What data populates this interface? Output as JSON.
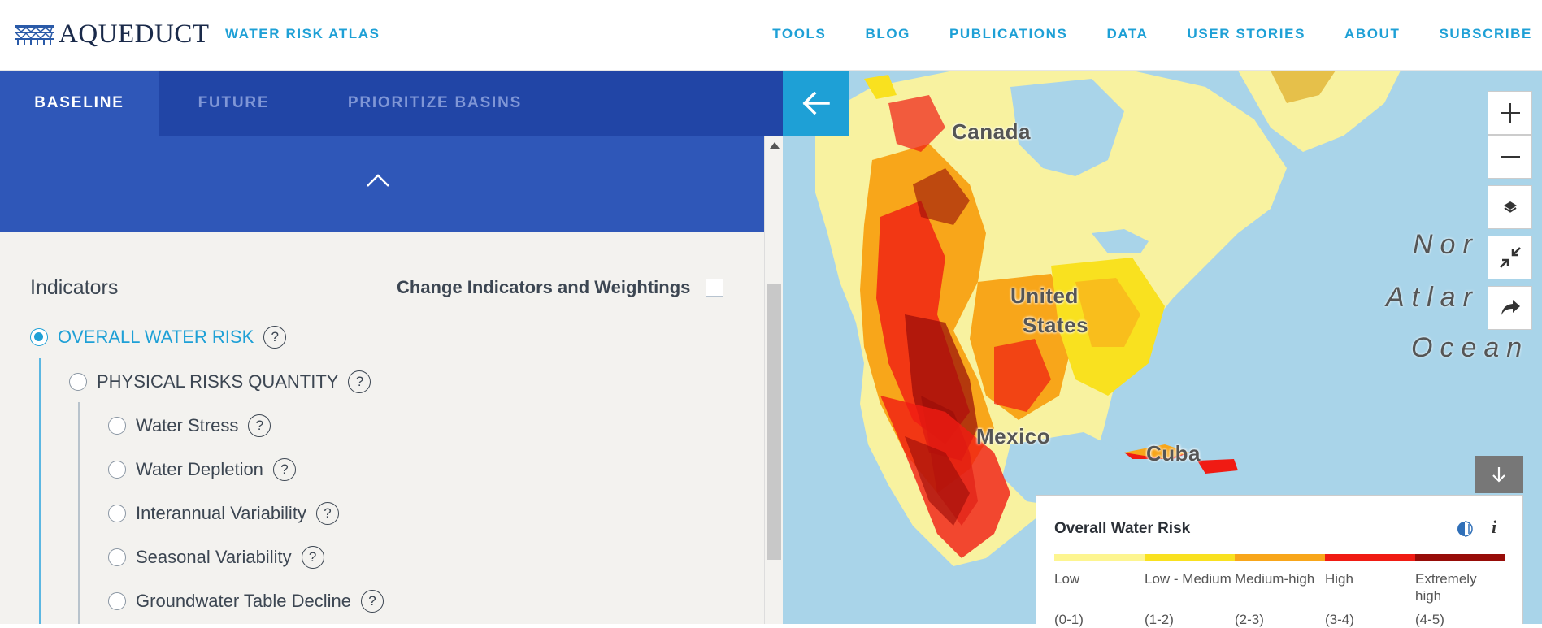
{
  "header": {
    "brand": "AQUEDUCT",
    "subtitle": "WATER RISK ATLAS",
    "nav": [
      "TOOLS",
      "BLOG",
      "PUBLICATIONS",
      "DATA",
      "USER STORIES",
      "ABOUT",
      "SUBSCRIBE"
    ]
  },
  "sidebar": {
    "tabs": [
      {
        "label": "BASELINE",
        "active": true
      },
      {
        "label": "FUTURE",
        "active": false
      },
      {
        "label": "PRIORITIZE BASINS",
        "active": false
      }
    ],
    "indicators_title": "Indicators",
    "change_label": "Change Indicators and Weightings",
    "items": [
      {
        "label": "OVERALL WATER RISK",
        "level": 0,
        "checked": true
      },
      {
        "label": "PHYSICAL RISKS QUANTITY",
        "level": 1,
        "checked": false
      },
      {
        "label": "Water Stress",
        "level": 2,
        "checked": false
      },
      {
        "label": "Water Depletion",
        "level": 2,
        "checked": false
      },
      {
        "label": "Interannual Variability",
        "level": 2,
        "checked": false
      },
      {
        "label": "Seasonal Variability",
        "level": 2,
        "checked": false
      },
      {
        "label": "Groundwater Table Decline",
        "level": 2,
        "checked": false
      }
    ],
    "help_glyph": "?"
  },
  "map": {
    "labels": {
      "canada": "Canada",
      "united": "United",
      "states": "States",
      "mexico": "Mexico",
      "cuba": "Cuba",
      "ocean_1": "Nor",
      "ocean_2": "Atlar",
      "ocean_3": "Ocean"
    },
    "controls": [
      "plus-icon",
      "minus-icon",
      "layers-icon",
      "collapse-icon",
      "share-icon"
    ]
  },
  "legend": {
    "title": "Overall Water Risk",
    "info_glyph": "i",
    "colors": [
      "#fdf590",
      "#f9e11f",
      "#f8a61a",
      "#f01b13",
      "#970c08"
    ],
    "categories": [
      {
        "name": "Low",
        "range": "(0-1)"
      },
      {
        "name": "Low - Medium",
        "range": "(1-2)"
      },
      {
        "name": "Medium-high",
        "range": "(2-3)"
      },
      {
        "name": "High",
        "range": "(3-4)"
      },
      {
        "name": "Extremely high",
        "range": "(4-5)"
      }
    ]
  },
  "colors": {
    "accent": "#1ea0d6",
    "tab_bar": "#2145a6",
    "tab_active": "#2f57b8"
  }
}
